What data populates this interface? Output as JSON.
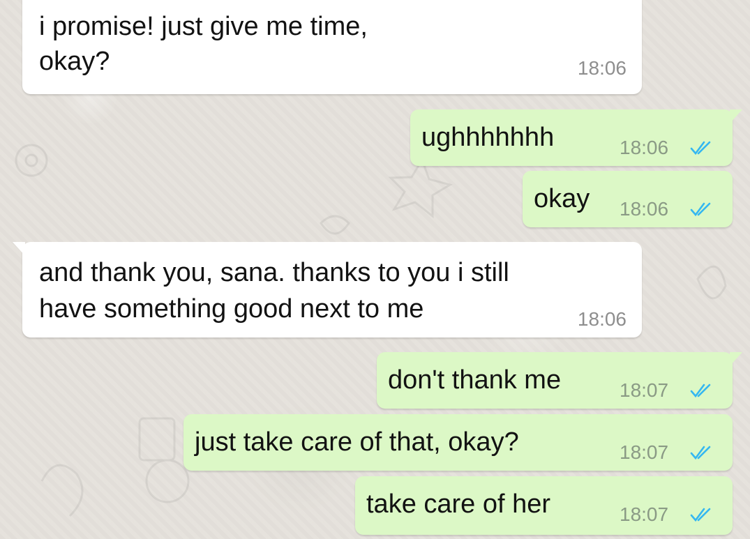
{
  "messages": [
    {
      "direction": "incoming",
      "lines": [
        "i promise! just give me time,",
        "okay?"
      ],
      "time": "18:06"
    },
    {
      "direction": "outgoing",
      "lines": [
        "ughhhhhhh"
      ],
      "time": "18:06",
      "status": "read"
    },
    {
      "direction": "outgoing",
      "lines": [
        "okay"
      ],
      "time": "18:06",
      "status": "read"
    },
    {
      "direction": "incoming",
      "lines": [
        "and thank you, sana. thanks to you i still",
        "have something good next to me"
      ],
      "time": "18:06"
    },
    {
      "direction": "outgoing",
      "lines": [
        "don't thank me"
      ],
      "time": "18:07",
      "status": "read"
    },
    {
      "direction": "outgoing",
      "lines": [
        "just take care of that, okay?"
      ],
      "time": "18:07",
      "status": "read"
    },
    {
      "direction": "outgoing",
      "lines": [
        "take care of her"
      ],
      "time": "18:07",
      "status": "read"
    }
  ],
  "theme": {
    "incoming_bubble": "#ffffff",
    "outgoing_bubble": "#dcf8c6",
    "read_tick_color": "#34b7f1",
    "background": "#e6e2dc"
  },
  "icons": {
    "read_receipt": "double-check-icon"
  }
}
